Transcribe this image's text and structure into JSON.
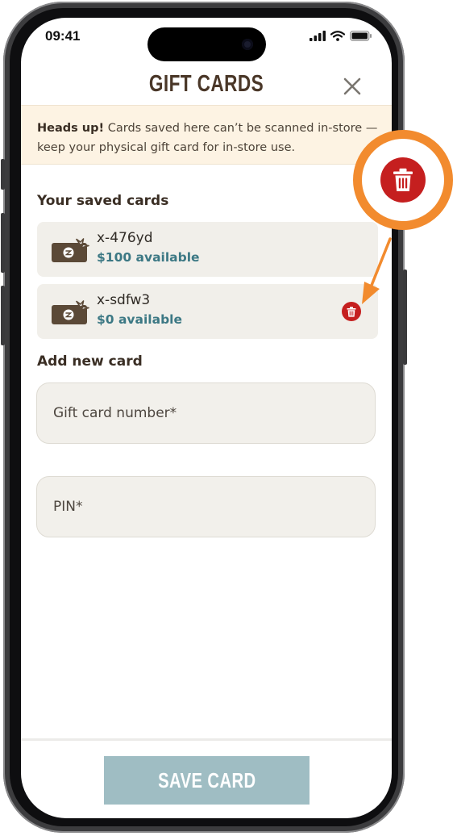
{
  "status_bar": {
    "time": "09:41",
    "icons": [
      "signal-icon",
      "wifi-icon",
      "battery-icon"
    ]
  },
  "header": {
    "title": "GIFT CARDS",
    "close_icon": "close-icon"
  },
  "banner": {
    "bold": "Heads up!",
    "text": " Cards saved here can’t be scanned in-store — keep your physical gift card for in-store use."
  },
  "saved_cards": {
    "title": "Your saved cards",
    "items": [
      {
        "id": "x-476yd",
        "balance": "$100 available",
        "icon": "gift-card-icon"
      },
      {
        "id": "x-sdfw3",
        "balance": "$0 available",
        "icon": "gift-card-icon",
        "delete_icon": "trash-icon"
      }
    ]
  },
  "add_card": {
    "title": "Add new card",
    "number_placeholder": "Gift card number*",
    "pin_placeholder": "PIN*"
  },
  "footer": {
    "save_label": "SAVE CARD"
  },
  "annotation": {
    "callout_icon": "trash-icon"
  },
  "colors": {
    "brand_brown": "#4a3728",
    "balance_teal": "#3c7884",
    "delete_red": "#c51f1f",
    "callout_orange": "#f28b2e",
    "banner_bg": "#fdf3e3",
    "save_button_bg": "#9fbdc3"
  }
}
